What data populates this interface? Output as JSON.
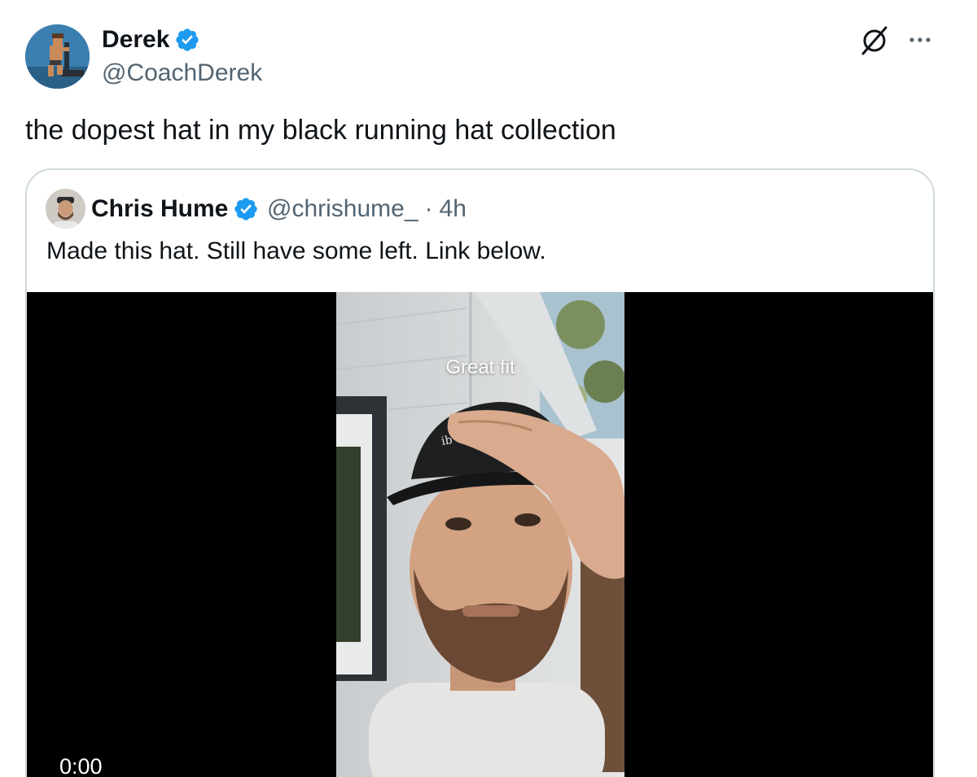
{
  "post": {
    "author_name": "Derek",
    "author_handle": "@CoachDerek",
    "text": "the dopest hat in my black running hat collection",
    "icons": [
      "verified-badge-icon",
      "grok-icon",
      "more-options-icon"
    ]
  },
  "quote": {
    "author_name": "Chris Hume",
    "author_handle": "@chrishume_",
    "separator": "·",
    "time": "4h",
    "text": "Made this hat. Still have some left. Link below.",
    "video": {
      "caption": "Great fit",
      "timestamp": "0:00"
    }
  },
  "colors": {
    "text_primary": "#0f1419",
    "text_secondary": "#536471",
    "verified_blue": "#1d9bf0",
    "border": "#cfd9de"
  }
}
